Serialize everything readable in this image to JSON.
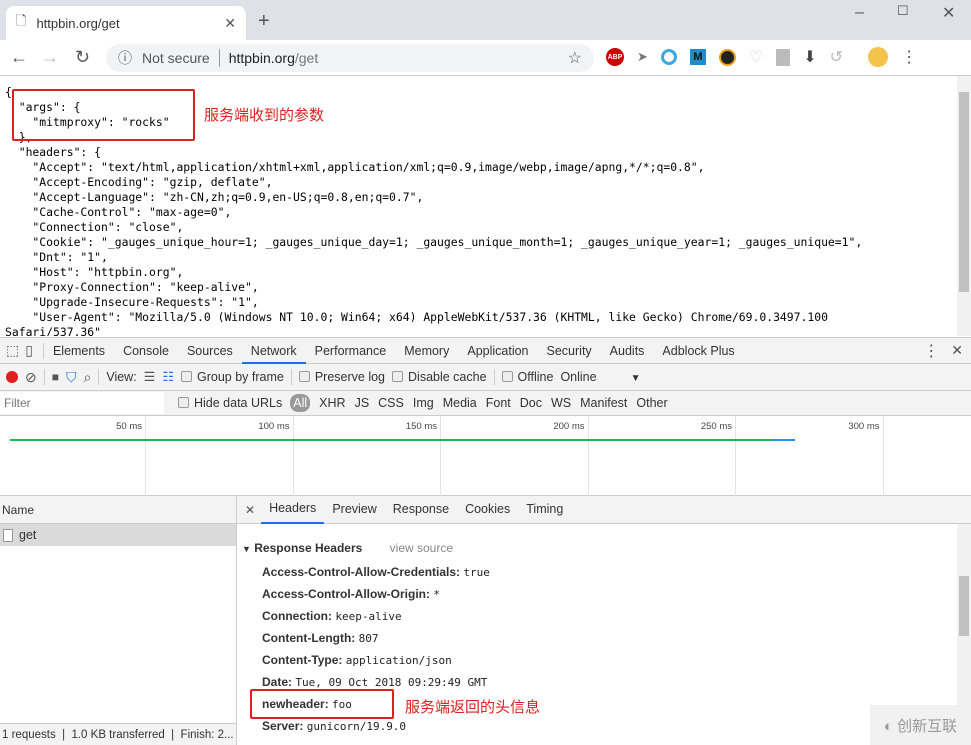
{
  "browser": {
    "tab_title": "httpbin.org/get",
    "security": "Not secure",
    "url_host": "httpbin.org",
    "url_path": "/get",
    "extensions": [
      "adblock-plus-icon",
      "cursor-icon",
      "circle-icon",
      "m-icon",
      "color-icon",
      "shield-icon",
      "rp-icon",
      "download-icon",
      "refresh-ext-icon",
      "avatar-icon"
    ]
  },
  "page": {
    "lines": [
      "{",
      "  \"args\": {",
      "    \"mitmproxy\": \"rocks\"",
      "  },",
      "  \"headers\": {",
      "    \"Accept\": \"text/html,application/xhtml+xml,application/xml;q=0.9,image/webp,image/apng,*/*;q=0.8\",",
      "    \"Accept-Encoding\": \"gzip, deflate\",",
      "    \"Accept-Language\": \"zh-CN,zh;q=0.9,en-US;q=0.8,en;q=0.7\",",
      "    \"Cache-Control\": \"max-age=0\",",
      "    \"Connection\": \"close\",",
      "    \"Cookie\": \"_gauges_unique_hour=1; _gauges_unique_day=1; _gauges_unique_month=1; _gauges_unique_year=1; _gauges_unique=1\",",
      "    \"Dnt\": \"1\",",
      "    \"Host\": \"httpbin.org\",",
      "    \"Proxy-Connection\": \"keep-alive\",",
      "    \"Upgrade-Insecure-Requests\": \"1\",",
      "    \"User-Agent\": \"Mozilla/5.0 (Windows NT 10.0; Win64; x64) AppleWebKit/537.36 (KHTML, like Gecko) Chrome/69.0.3497.100",
      "Safari/537.36\""
    ],
    "annotation_args": "服务端收到的参数"
  },
  "devtools": {
    "tabs": [
      "Elements",
      "Console",
      "Sources",
      "Network",
      "Performance",
      "Memory",
      "Application",
      "Security",
      "Audits",
      "Adblock Plus"
    ],
    "active_tab": "Network",
    "toolbar": {
      "view_label": "View:",
      "group_by_frame": "Group by frame",
      "preserve_log": "Preserve log",
      "disable_cache": "Disable cache",
      "offline": "Offline",
      "throttle": "Online"
    },
    "filter": {
      "placeholder": "Filter",
      "hide_data_urls": "Hide data URLs",
      "types": [
        "All",
        "XHR",
        "JS",
        "CSS",
        "Img",
        "Media",
        "Font",
        "Doc",
        "WS",
        "Manifest",
        "Other"
      ]
    },
    "timeline": {
      "ticks": [
        "50 ms",
        "100 ms",
        "150 ms",
        "200 ms",
        "250 ms",
        "300 ms"
      ],
      "colors": {
        "waiting": "#1db954",
        "download": "#2196f3"
      }
    },
    "requests": {
      "column": "Name",
      "items": [
        "get"
      ],
      "status": "1 requests  |  1.0 KB transferred  |  Finish: 2..."
    },
    "detail": {
      "tabs": [
        "Headers",
        "Preview",
        "Response",
        "Cookies",
        "Timing"
      ],
      "active": "Headers",
      "section": "Response Headers",
      "view_source": "view source",
      "headers": [
        [
          "Access-Control-Allow-Credentials:",
          "true"
        ],
        [
          "Access-Control-Allow-Origin:",
          "*"
        ],
        [
          "Connection:",
          "keep-alive"
        ],
        [
          "Content-Length:",
          "807"
        ],
        [
          "Content-Type:",
          "application/json"
        ],
        [
          "Date:",
          "Tue, 09 Oct 2018 09:29:49 GMT"
        ],
        [
          "newheader:",
          "foo"
        ],
        [
          "Server:",
          "gunicorn/19.9.0"
        ]
      ],
      "annotation": "服务端返回的头信息"
    }
  },
  "watermark": "创新互联"
}
